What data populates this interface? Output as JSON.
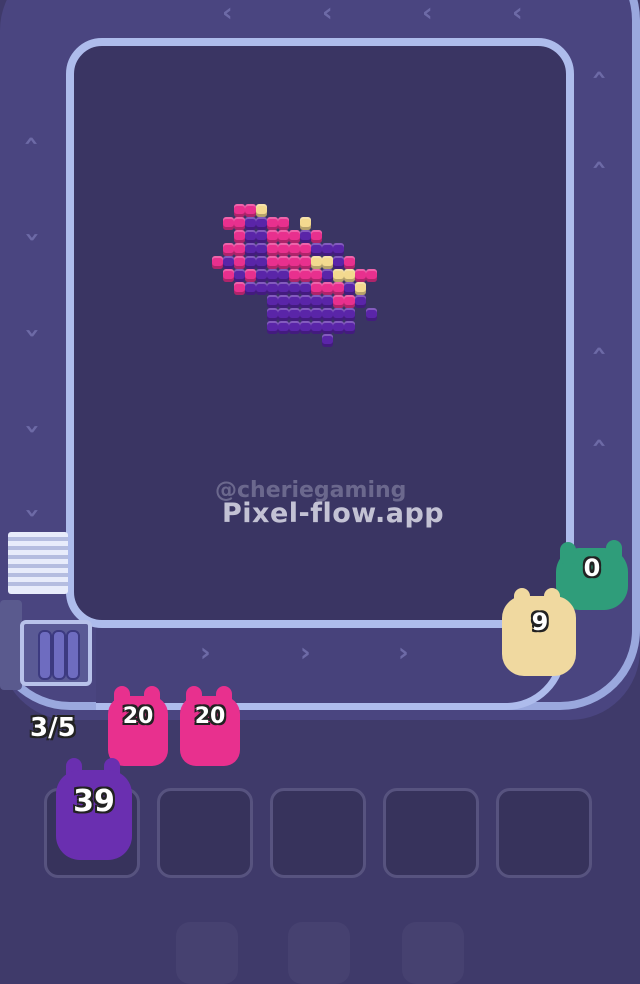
{
  "watermark": {
    "handle": "@cheriegaming",
    "site": "Pixel-flow.app"
  },
  "queue": {
    "counter": "3/5",
    "pigs": [
      {
        "value": "20",
        "color": "#e8308e"
      },
      {
        "value": "20",
        "color": "#e8308e"
      }
    ]
  },
  "belt_shooters": [
    {
      "value": "0",
      "color": "#2f9d7a"
    },
    {
      "value": "9",
      "color": "#f0d9a0"
    }
  ],
  "slots": {
    "count": 5,
    "filled": [
      {
        "value": "39",
        "color": "#6a2fb0"
      }
    ]
  },
  "palette": {
    "magenta": "#e8308e",
    "purple": "#5a25a8",
    "cream": "#f3d98f",
    "background": "#3f3a6a",
    "rail": "#aebcec"
  },
  "pixel_art": {
    "rows": [
      "..MMC...........",
      ".MMPPMM.C.......",
      "..MPPMMMPM......",
      ".MMPPMMMMPPP....",
      "MPMPPMMMMCCPM...",
      ".MPMPPPMMMPCCMM.",
      "..MPPPPPPMMMPC..",
      ".....PPPPPPMMP..",
      ".....PPPPPPPP.P.",
      ".....PPPPPPPP...",
      "..........P....."
    ]
  }
}
